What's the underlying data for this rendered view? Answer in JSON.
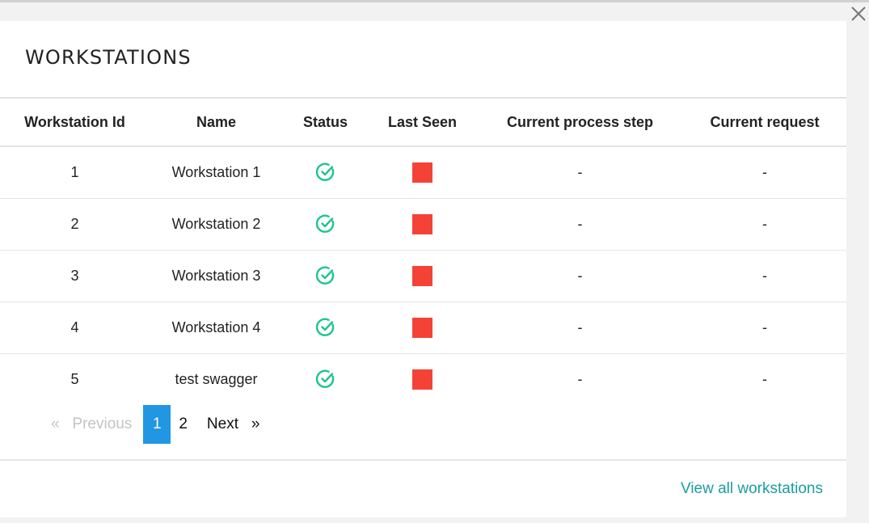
{
  "header": {
    "title": "WORKSTATIONS",
    "close_icon": "close-icon"
  },
  "table": {
    "columns": [
      "Workstation Id",
      "Name",
      "Status",
      "Last Seen",
      "Current process step",
      "Current request"
    ],
    "rows": [
      {
        "id": "1",
        "name": "Workstation 1",
        "status_icon": "check-circle-icon",
        "last_seen": "red-square",
        "process_step": "-",
        "request": "-"
      },
      {
        "id": "2",
        "name": "Workstation 2",
        "status_icon": "check-circle-icon",
        "last_seen": "red-square",
        "process_step": "-",
        "request": "-"
      },
      {
        "id": "3",
        "name": "Workstation 3",
        "status_icon": "check-circle-icon",
        "last_seen": "red-square",
        "process_step": "-",
        "request": "-"
      },
      {
        "id": "4",
        "name": "Workstation 4",
        "status_icon": "check-circle-icon",
        "last_seen": "red-square",
        "process_step": "-",
        "request": "-"
      },
      {
        "id": "5",
        "name": "test swagger",
        "status_icon": "check-circle-icon",
        "last_seen": "red-square",
        "process_step": "-",
        "request": "-"
      }
    ]
  },
  "pagination": {
    "prev_icon": "«",
    "prev_label": "Previous",
    "pages": [
      "1",
      "2"
    ],
    "current_page": "1",
    "next_label": "Next",
    "next_icon": "»"
  },
  "footer": {
    "view_all_label": "View all workstations"
  },
  "colors": {
    "status_ok": "#1fc48a",
    "last_seen_stale": "#f44336",
    "active_page": "#2196e3",
    "link": "#1a9ea0"
  }
}
